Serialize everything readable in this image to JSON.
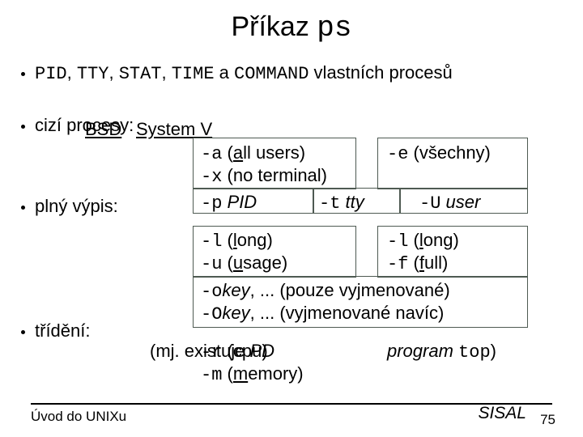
{
  "title_text": "Příkaz ",
  "title_cmd": "ps",
  "line1_pre": "PID",
  "line1_c": ", ",
  "line1_tty": "TTY",
  "line1_stat": "STAT",
  "line1_time": "TIME",
  "line1_a": " a ",
  "line1_cmd": "COMMAND",
  "line1_post": " vlastních procesů",
  "hdr_bsd": "BSD",
  "hdr_sv": "System V",
  "lbl_cizi": "cizí procesy:",
  "lbl_plny": "plný výpis:",
  "lbl_trid": "třídění:",
  "a_flag": "-a",
  "a_txt_open": " (",
  "a_u": "a",
  "a_txt_close": "ll users)",
  "x_flag": "-x",
  "x_txt": " (no terminal)",
  "e_flag": "-e",
  "e_txt": " (všechny)",
  "p_flag": "-p",
  "p_arg": " PID",
  "t_flag": "-t",
  "t_arg": " tty",
  "Uu_flag": "-U",
  "Uu_arg": " user",
  "l_flag": "-l",
  "l_txt_open": " (",
  "l_u": "l",
  "l_txt_close": "ong)",
  "u_flag": "-u",
  "u_txt_open": " (",
  "u_u": "u",
  "u_txt_close": "sage)",
  "l2_flag": "-l",
  "l2_txt_open": " (",
  "l2_u": "l",
  "l2_txt_close": "ong)",
  "f_flag": "-f",
  "f_txt_open": " (",
  "f_u": "f",
  "f_txt_close": "ull)",
  "o1_flag": "-o",
  "o1_key": "key",
  "o1_txt": ", ... (pouze vyjmenované)",
  "o2_flag": "-O",
  "o2_key": "key",
  "o2_txt": ", ... (vyjmenované navíc)",
  "trid_pre": "(mj. existuje ",
  "trid_mid": "PD",
  "trid_r_flag": "-r",
  "trid_r_open": " (",
  "trid_r_cpu": "cpu",
  "trid_r_close": ")",
  "trid_m_flag": "-m",
  "trid_m_open": " (",
  "trid_m_u": "m",
  "trid_m_close": "emory)",
  "trid_prog": "program ",
  "trid_top": "top",
  "trid_paren": ")",
  "footer_left": "Úvod do UNIXu",
  "footer_right": "SISAL",
  "page": "75"
}
